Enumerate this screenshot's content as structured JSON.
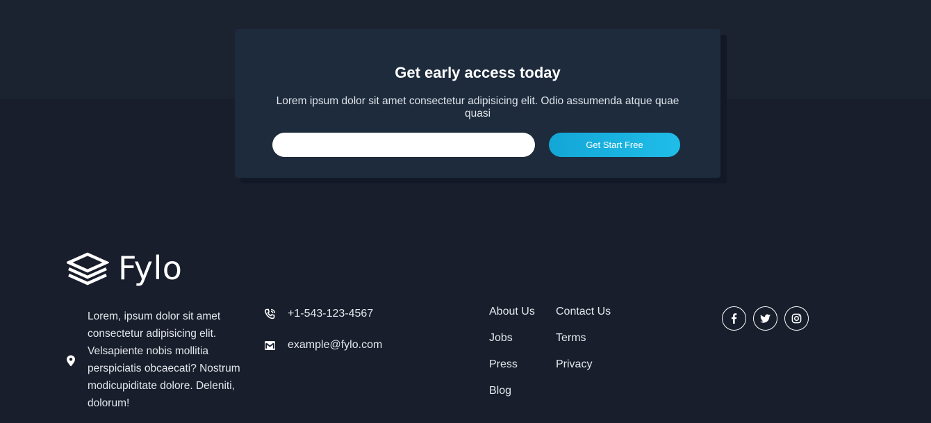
{
  "cta": {
    "title": "Get early access today",
    "description": "Lorem ipsum dolor sit amet consectetur adipisicing elit. Odio assumenda atque quae quasi",
    "email_placeholder": "",
    "button_label": "Get Start Free"
  },
  "brand": {
    "name": "Fylo",
    "logo_icon": "stacked-layers-icon"
  },
  "footer": {
    "address": {
      "icon": "location-pin-icon",
      "text": "Lorem, ipsum dolor sit amet consectetur adipisicing elit. Velsapiente nobis mollitia perspiciatis obcaecati? Nostrum modicupiditate dolore. Deleniti, dolorum!"
    },
    "phone": {
      "icon": "phone-icon",
      "text": "+1-543-123-4567"
    },
    "email": {
      "icon": "mail-icon",
      "text": "example@fylo.com"
    },
    "links_column_1": [
      "About Us",
      "Jobs",
      "Press",
      "Blog"
    ],
    "links_column_2": [
      "Contact Us",
      "Terms",
      "Privacy"
    ],
    "socials": [
      "facebook-icon",
      "twitter-icon",
      "instagram-icon"
    ]
  },
  "colors": {
    "background_top": "#1b2230",
    "background_bottom": "#181e2b",
    "card": "#1d2b3c",
    "accent": "#1bb3e3",
    "text": "#e4e7ec"
  }
}
